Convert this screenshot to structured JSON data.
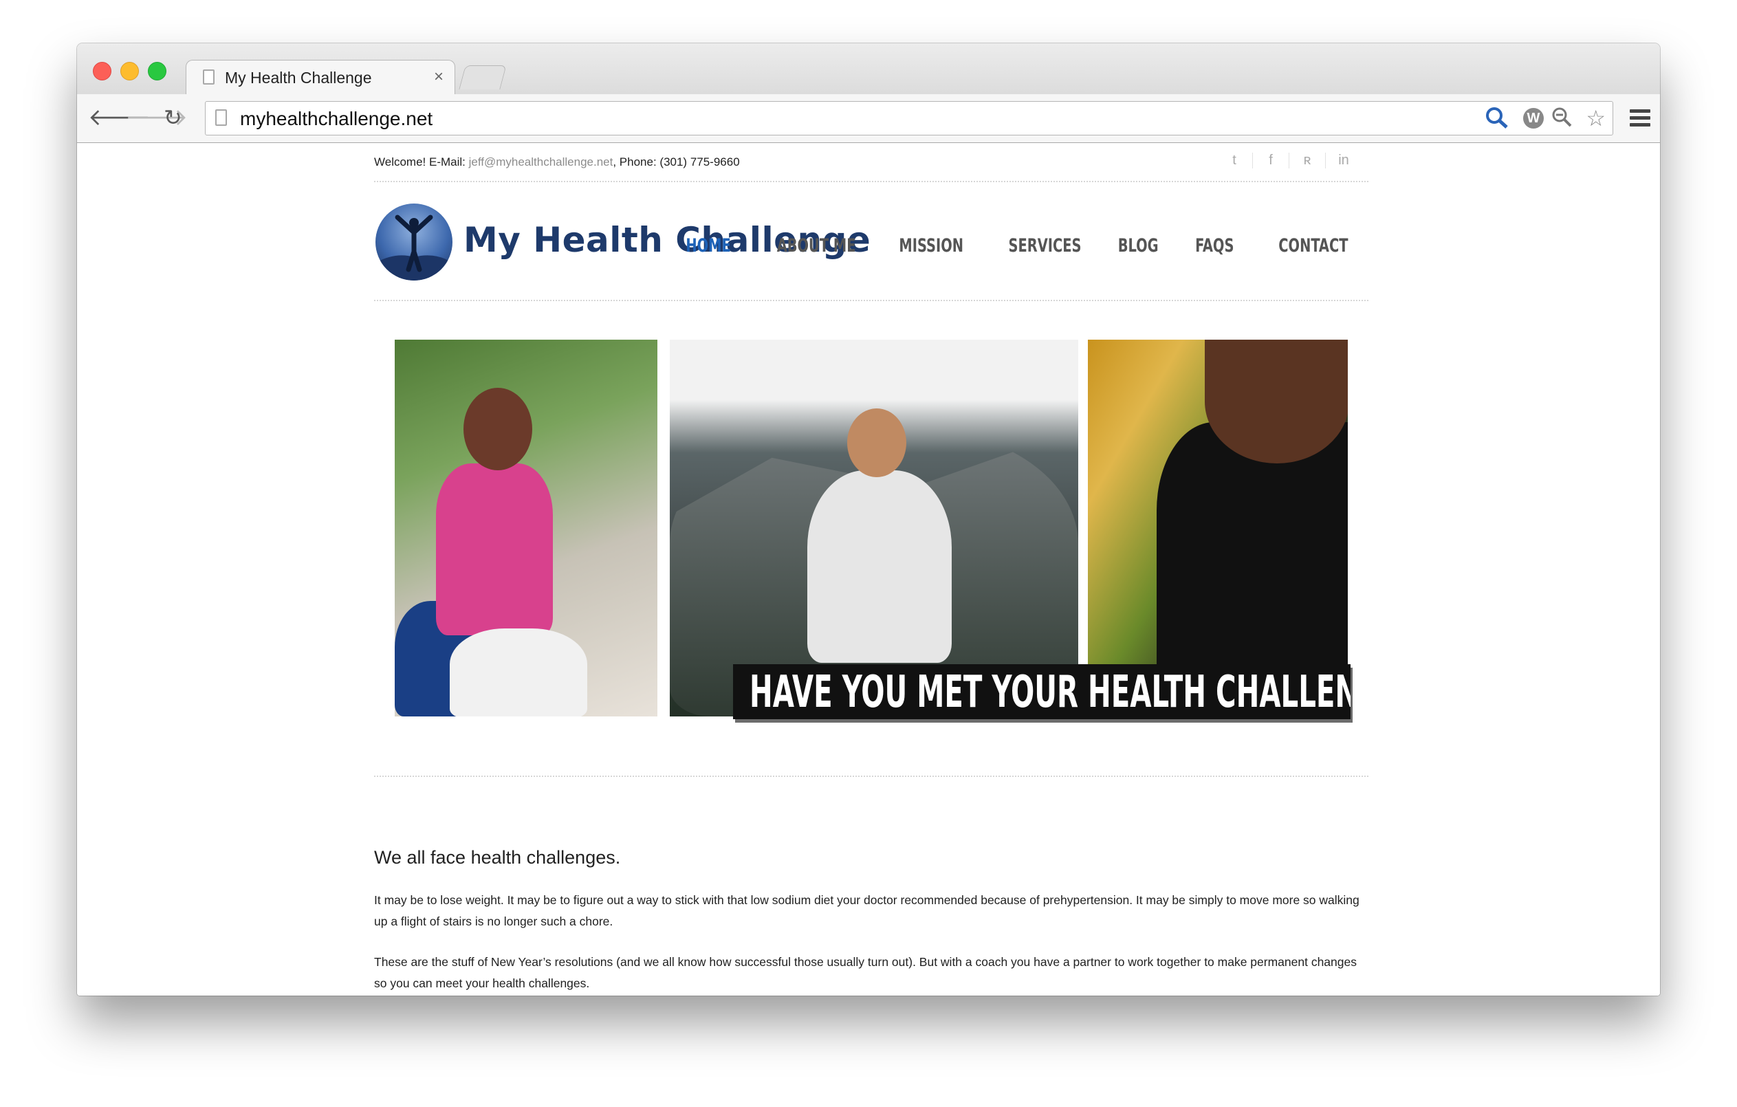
{
  "browser": {
    "tab_title": "My Health Challenge",
    "tab_close": "×",
    "url": "myhealthchallenge.net",
    "back_icon": "🡐",
    "forward_icon": "🡒",
    "reload_icon": "↻",
    "star_icon": "☆",
    "wp_label": "W"
  },
  "topbar": {
    "welcome_prefix": "Welcome! E-Mail: ",
    "email": "jeff@myhealthchallenge.net",
    "phone_text": ", Phone: (301) 775-9660",
    "social": [
      "twitter-icon",
      "facebook-icon",
      "rss-icon",
      "linkedin-icon"
    ],
    "social_glyphs": [
      "t",
      "f",
      "ʀ",
      "in"
    ]
  },
  "header": {
    "site_title": "My Health Challenge",
    "nav": [
      "HOME",
      "ABOUT ME",
      "MISSION",
      "SERVICES",
      "BLOG",
      "FAQS",
      "CONTACT"
    ],
    "active_nav": "HOME"
  },
  "hero": {
    "banner": "HAVE YOU MET YOUR HEALTH CHALLENGE?"
  },
  "intro": {
    "title": "We all face health challenges.",
    "p1": "It may be to lose weight. It may be to figure out a way to stick with that low sodium diet your doctor recommended because of prehypertension. It may be simply to move more so walking up a flight of stairs is no longer such a chore.",
    "p2": "These are the stuff of New Year’s resolutions (and we all know how successful those usually turn out). But with a coach you have a partner to work together to make permanent changes so you can meet your health challenges."
  },
  "colors": {
    "nav_active": "#1e63b8",
    "logo_text": "#1e3a6b",
    "email_link": "#8c8c8c"
  }
}
